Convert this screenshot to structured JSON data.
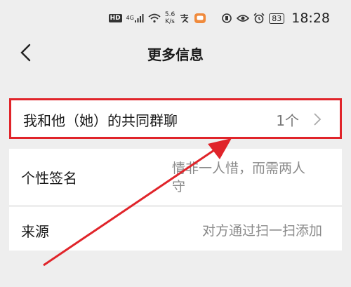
{
  "status_bar": {
    "hd": "HD",
    "network": "4G",
    "speed_value": "5.6",
    "speed_unit": "K/s",
    "battery": "83",
    "time": "18:28",
    "icons": [
      "hd-icon",
      "signal-icon",
      "wifi-icon",
      "pay-icon",
      "message-icon",
      "vibrate-icon",
      "eye-icon",
      "alarm-icon",
      "battery-icon"
    ]
  },
  "nav": {
    "title": "更多信息",
    "back_icon": "chevron-left-icon"
  },
  "rows": {
    "groups": {
      "label": "我和他（她）的共同群聊",
      "count": "1个"
    },
    "signature": {
      "label": "个性签名",
      "value": "情非一人惜，而需两人守"
    },
    "source": {
      "label": "来源",
      "value": "对方通过扫一扫添加"
    }
  },
  "colors": {
    "highlight": "#e0242a",
    "background": "#eeeeee"
  }
}
